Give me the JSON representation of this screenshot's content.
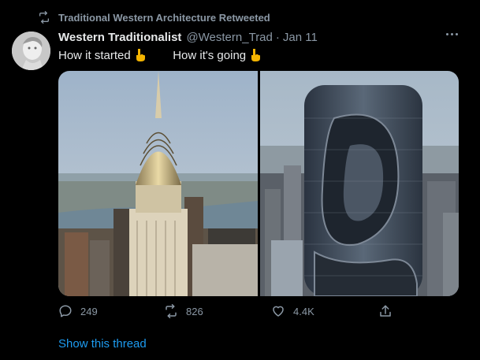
{
  "retweet_bar": {
    "text": "Traditional Western Architecture Retweeted",
    "icon": "retweet-icon"
  },
  "tweet": {
    "display_name": "Western Traditionalist",
    "handle": "@Western_Trad",
    "separator": "·",
    "date": "Jan 11",
    "text_part1": "How it started",
    "text_part2": "How it's going",
    "emoji": "pointing-down-icon"
  },
  "actions": {
    "reply_count": "249",
    "retweet_count": "826",
    "like_count": "4.4K"
  },
  "show_thread": "Show this thread",
  "colors": {
    "background": "#000000",
    "muted": "#8b98a5",
    "primary_text": "#e7e9ea",
    "link": "#1d9bf0",
    "emoji": "#f4b400"
  }
}
